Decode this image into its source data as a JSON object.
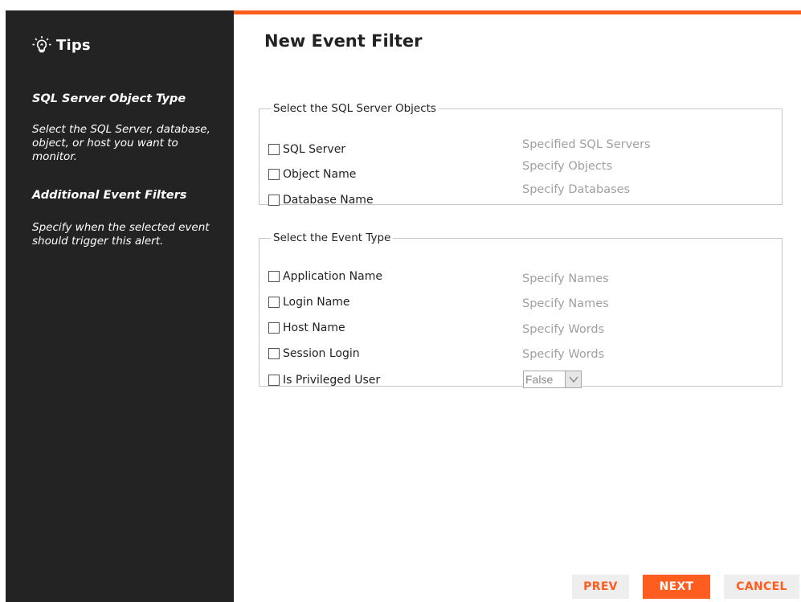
{
  "sidebar": {
    "title": "Tips",
    "sections": [
      {
        "heading": "SQL Server Object Type",
        "body": "Select the SQL Server, database, object, or host you want to monitor."
      },
      {
        "heading": "Additional Event Filters",
        "body": "Specify when the selected event should trigger this alert."
      }
    ]
  },
  "page": {
    "title": "New Event Filter"
  },
  "objects_group": {
    "legend": "Select the SQL Server Objects",
    "items": [
      {
        "label": "SQL Server",
        "checked": false
      },
      {
        "label": "Object Name",
        "checked": false
      },
      {
        "label": "Database Name",
        "checked": false
      }
    ],
    "links": [
      "Specified SQL Servers",
      "Specify Objects",
      "Specify Databases"
    ]
  },
  "event_group": {
    "legend": "Select the Event Type",
    "items": [
      {
        "label": "Application Name",
        "checked": false,
        "link": "Specify Names"
      },
      {
        "label": "Login Name",
        "checked": false,
        "link": "Specify Names"
      },
      {
        "label": "Host Name",
        "checked": false,
        "link": "Specify Words"
      },
      {
        "label": "Session Login",
        "checked": false,
        "link": "Specify Words"
      },
      {
        "label": "Is Privileged User",
        "checked": false,
        "select_value": "False"
      }
    ]
  },
  "buttons": {
    "prev": "PREV",
    "next": "NEXT",
    "cancel": "CANCEL"
  },
  "colors": {
    "accent": "#ff5c1f",
    "sidebar_bg": "#232323",
    "link_gray": "#a0a0a0"
  },
  "icons": {
    "tips": "lightbulb-icon",
    "select_arrow": "chevron-down-icon"
  }
}
